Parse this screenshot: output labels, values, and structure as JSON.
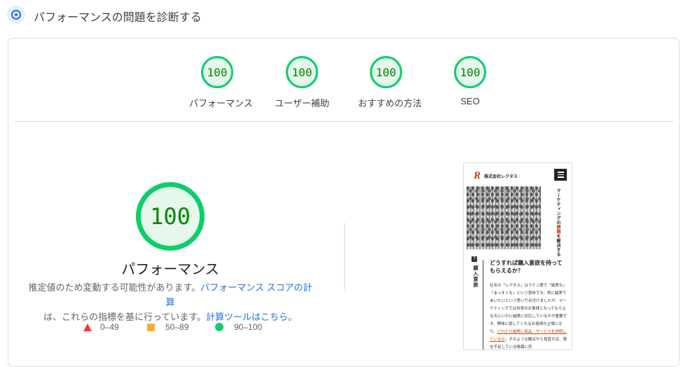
{
  "header": {
    "title": "パフォーマンスの問題を診断する",
    "icon": "diagnose-icon",
    "accent": "#1a73e8"
  },
  "categories": [
    {
      "score": "100",
      "label": "パフォーマンス"
    },
    {
      "score": "100",
      "label": "ユーザー補助"
    },
    {
      "score": "100",
      "label": "おすすめの方法"
    },
    {
      "score": "100",
      "label": "SEO"
    }
  ],
  "main": {
    "score": "100",
    "label": "パフォーマンス",
    "desc_1": "推定値のため変動する可能性があります。",
    "link_1": "パフォーマンス スコアの計算",
    "desc_2": "は、これらの指標を基に行っています。",
    "link_2": "計算ツールはこちら。"
  },
  "legend": [
    {
      "range": "0–49",
      "color": "#ff3333",
      "shape": "triangle"
    },
    {
      "range": "50–89",
      "color": "#ffaa33",
      "shape": "square"
    },
    {
      "range": "90–100",
      "color": "#0cce6b",
      "shape": "circle"
    }
  ],
  "screenshot": {
    "logo": "R",
    "brand": "株式会社レクタス",
    "hero_vertical_1": "マーケティングの",
    "hero_vertical_red": "課題",
    "hero_vertical_2": "を解決する",
    "side_icon": "?",
    "side_label": "購入意欲",
    "heading": "どうすれば購入意欲を持ってもらえるか？",
    "body_1": "社名の「レクタス」はラテン語で「誠実な」「まっすぐな」という意味です。常に誠実であいたいという思いで名付けましたが、マーケティングでは何来のお客様となってもらえる方にいかに誠実に対応しているかが重要です。興味に感してくれるお客様の立場になり、",
    "body_highlight": "どれだけ誠実に商品・サービスを説明しているか",
    "body_2": "。そのような観点から見直せば、現在不足している情報に気"
  },
  "colors": {
    "pass": "#0cce6b",
    "pass_text": "#008800",
    "pass_bg": "#e6f7ec",
    "link": "#1a73e8"
  }
}
